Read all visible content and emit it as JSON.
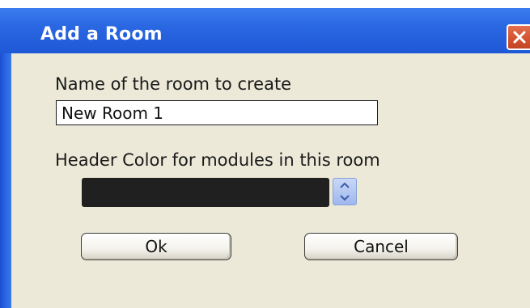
{
  "window": {
    "title": "Add a Room",
    "close_icon": "close-icon"
  },
  "form": {
    "name_label": "Name of the room to create",
    "name_value": "New Room 1",
    "color_label": "Header Color for modules in this room",
    "header_color": "#202020",
    "spinner_icon": "spin-up-down-icon"
  },
  "buttons": {
    "ok_label": "Ok",
    "cancel_label": "Cancel"
  },
  "colors": {
    "titlebar": "#2a67e2",
    "close_button": "#d2522e",
    "dialog_background": "#ece9d8"
  }
}
